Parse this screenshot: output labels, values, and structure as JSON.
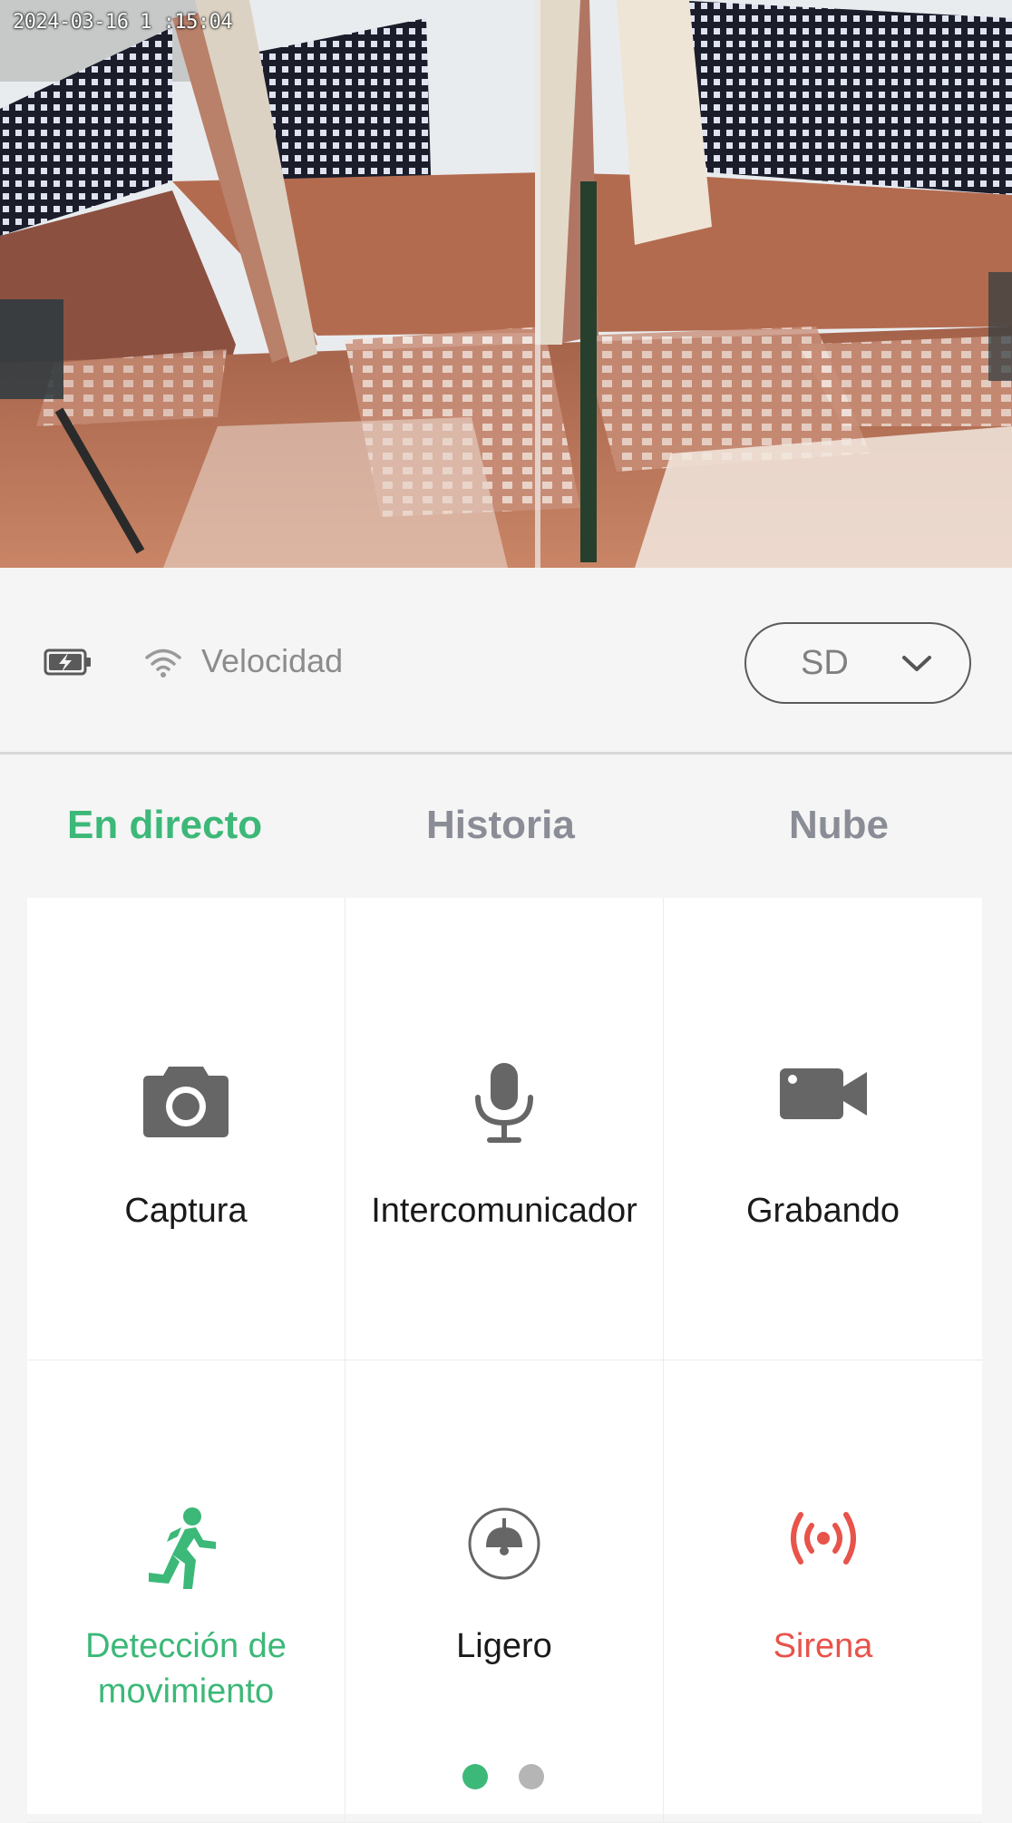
{
  "camera": {
    "timestamp": "2024-03-16 1 :15:04"
  },
  "status": {
    "battery_icon": "battery-charging-icon",
    "wifi_icon": "wifi-icon",
    "speed_label": "Velocidad",
    "quality": "SD"
  },
  "tabs": [
    {
      "label": "En directo",
      "active": true
    },
    {
      "label": "Historia",
      "active": false
    },
    {
      "label": "Nube",
      "active": false
    }
  ],
  "controls": [
    {
      "label": "Captura",
      "icon": "camera-icon"
    },
    {
      "label": "Intercomunicador",
      "icon": "microphone-icon"
    },
    {
      "label": "Grabando",
      "icon": "video-camera-icon"
    },
    {
      "label": "Detección de movimiento",
      "icon": "motion-detection-icon",
      "color": "#3cb878"
    },
    {
      "label": "Ligero",
      "icon": "lamp-icon"
    },
    {
      "label": "Sirena",
      "icon": "siren-icon",
      "color": "#e8534a"
    }
  ],
  "pager": {
    "pages": 2,
    "current": 1
  },
  "colors": {
    "accent": "#3cb878",
    "alert": "#e8534a",
    "inactive_tab": "#8a8d96"
  }
}
